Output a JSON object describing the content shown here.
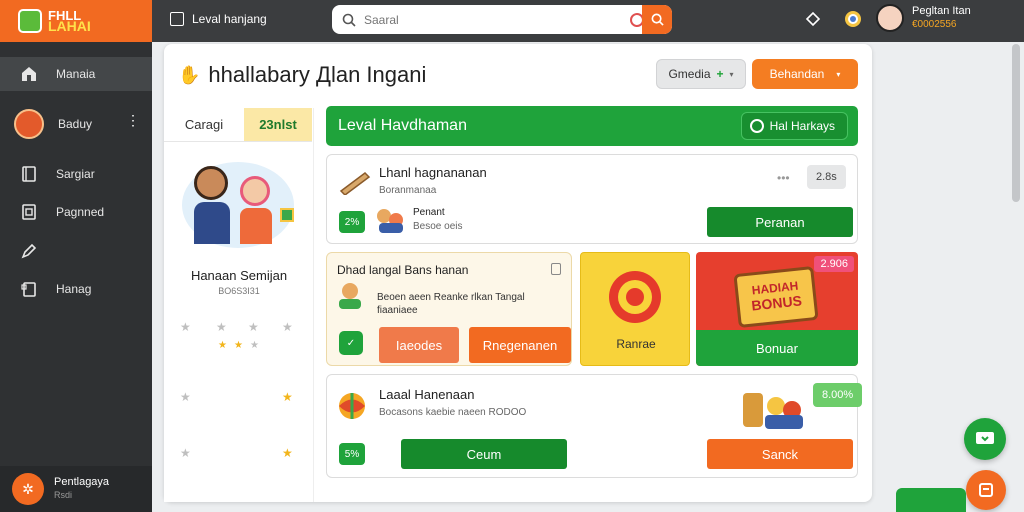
{
  "app": {
    "logo_line1": "FHLL",
    "logo_line2": "LAHAI"
  },
  "sidebar": {
    "items": [
      {
        "label": "Manaia",
        "icon": "home-icon",
        "active": true
      },
      {
        "label": "Baduy",
        "icon": "avatar-icon"
      },
      {
        "label": "Sargiar",
        "icon": "book-icon"
      },
      {
        "label": "Pagnned",
        "icon": "grid-icon"
      },
      {
        "label": "",
        "icon": "pen-icon"
      },
      {
        "label": "Hanag",
        "icon": "notes-icon"
      }
    ],
    "footer": {
      "label": "Pentlagaya",
      "sub": "Rsdi"
    }
  },
  "topbar": {
    "breadcrumb": "Leval hanjang",
    "search_placeholder": "Saaral",
    "user": {
      "name": "Pegltan Itan",
      "points": "€0002556"
    }
  },
  "main": {
    "greeting_icon": "wave-hand-icon",
    "title": "hhallabary Дlan Ingani",
    "btn_media": "Gmedia",
    "btn_beh": "Behandan"
  },
  "profile": {
    "tabs": [
      "Caragi",
      "23nlst"
    ],
    "name": "Hanaan Semijan",
    "sub": "BO6S3I31"
  },
  "banner": {
    "title": "Leval Havdhaman",
    "pill": "Hal Harkays"
  },
  "level_card": {
    "title": "Lhanl hagnananan",
    "sub": "Boranmanaa",
    "chip": "2.8s",
    "badge": "2%",
    "learner_name": "Penant",
    "learner_sub": "Besoe oeis",
    "action": "Peranan"
  },
  "task_card": {
    "title": "Dhad langal Bans hanan",
    "text": "Beoen aeen Reanke rlkan Tangal fiaaniaee",
    "btn1": "Iaeodes",
    "btn2": "Rnegenanen"
  },
  "tiles": [
    {
      "label": "Ranrae",
      "color": "#f8d33a"
    },
    {
      "label": "Bonuar",
      "badge": "2.906",
      "sign1": "HADIAH",
      "sign2": "BONUS"
    }
  ],
  "bottom_card": {
    "title": "Laaal Hanenaan",
    "sub": "Bocasons kaebie naeen RODOO",
    "badge": "5%",
    "chip": "8.00%",
    "btn1": "Ceum",
    "btn2": "Sanck"
  },
  "colors": {
    "orange": "#f26a21",
    "green": "#1fa33b",
    "dark_green": "#168a2c",
    "sidebar": "#2f3133"
  }
}
